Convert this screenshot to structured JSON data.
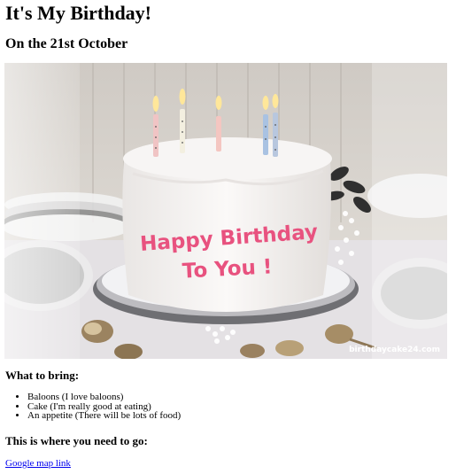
{
  "page": {
    "title": "It's My Birthday!",
    "date_heading": "On the 21st October"
  },
  "image": {
    "cake_text_line1": "Happy Birthday",
    "cake_text_line2": "To You !",
    "watermark": "birthdaycake24.com"
  },
  "bring": {
    "heading": "What to bring:",
    "items": [
      "Baloons (I love baloons)",
      "Cake (I'm really good at eating)",
      "An appetite (There will be lots of food)"
    ]
  },
  "location": {
    "heading": "This is where you need to go:",
    "link_text": "Google map link"
  }
}
